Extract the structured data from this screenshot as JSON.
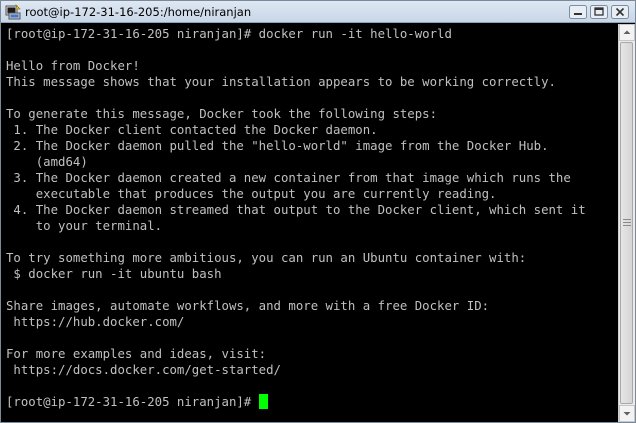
{
  "window": {
    "title": "root@ip-172-31-16-205:/home/niranjan"
  },
  "terminal": {
    "lines": [
      "[root@ip-172-31-16-205 niranjan]# docker run -it hello-world",
      "",
      "Hello from Docker!",
      "This message shows that your installation appears to be working correctly.",
      "",
      "To generate this message, Docker took the following steps:",
      " 1. The Docker client contacted the Docker daemon.",
      " 2. The Docker daemon pulled the \"hello-world\" image from the Docker Hub.",
      "    (amd64)",
      " 3. The Docker daemon created a new container from that image which runs the",
      "    executable that produces the output you are currently reading.",
      " 4. The Docker daemon streamed that output to the Docker client, which sent it",
      "    to your terminal.",
      "",
      "To try something more ambitious, you can run an Ubuntu container with:",
      " $ docker run -it ubuntu bash",
      "",
      "Share images, automate workflows, and more with a free Docker ID:",
      " https://hub.docker.com/",
      "",
      "For more examples and ideas, visit:",
      " https://docs.docker.com/get-started/",
      ""
    ],
    "prompt": "[root@ip-172-31-16-205 niranjan]# ",
    "cursor_color": "#00ff00",
    "text_color": "#c0c0c0",
    "background_color": "#000000"
  },
  "icons": {
    "app": "putty-terminal-icon",
    "minimize": "minimize-icon",
    "maximize": "maximize-icon",
    "close": "close-icon"
  }
}
